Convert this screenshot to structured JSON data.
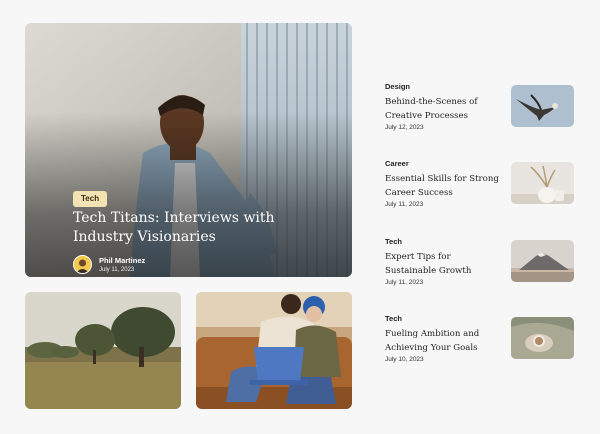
{
  "hero": {
    "category": "Tech",
    "title": "Tech Titans: Interviews with Industry Visionaries",
    "author": "Phil Martinez",
    "date": "July 11, 2023"
  },
  "tiles": [
    {
      "image": "landscape-photo"
    },
    {
      "image": "friends-laptop-photo"
    }
  ],
  "sidebar": {
    "items": [
      {
        "category": "Design",
        "title": "Behind-the-Scenes of Creative Processes",
        "date": "July 12, 2023",
        "image": "bird-photo"
      },
      {
        "category": "Career",
        "title": "Essential Skills for Strong Career Success",
        "date": "July 11, 2023",
        "image": "vase-photo"
      },
      {
        "category": "Tech",
        "title": "Expert Tips for Sustainable Growth",
        "date": "July 11, 2023",
        "image": "mountain-photo"
      },
      {
        "category": "Tech",
        "title": "Fueling Ambition and Achieving Your Goals",
        "date": "July 10, 2023",
        "image": "coffee-photo"
      }
    ]
  },
  "colors": {
    "badge": "#f3e3b3",
    "background": "#f7f7f8"
  }
}
